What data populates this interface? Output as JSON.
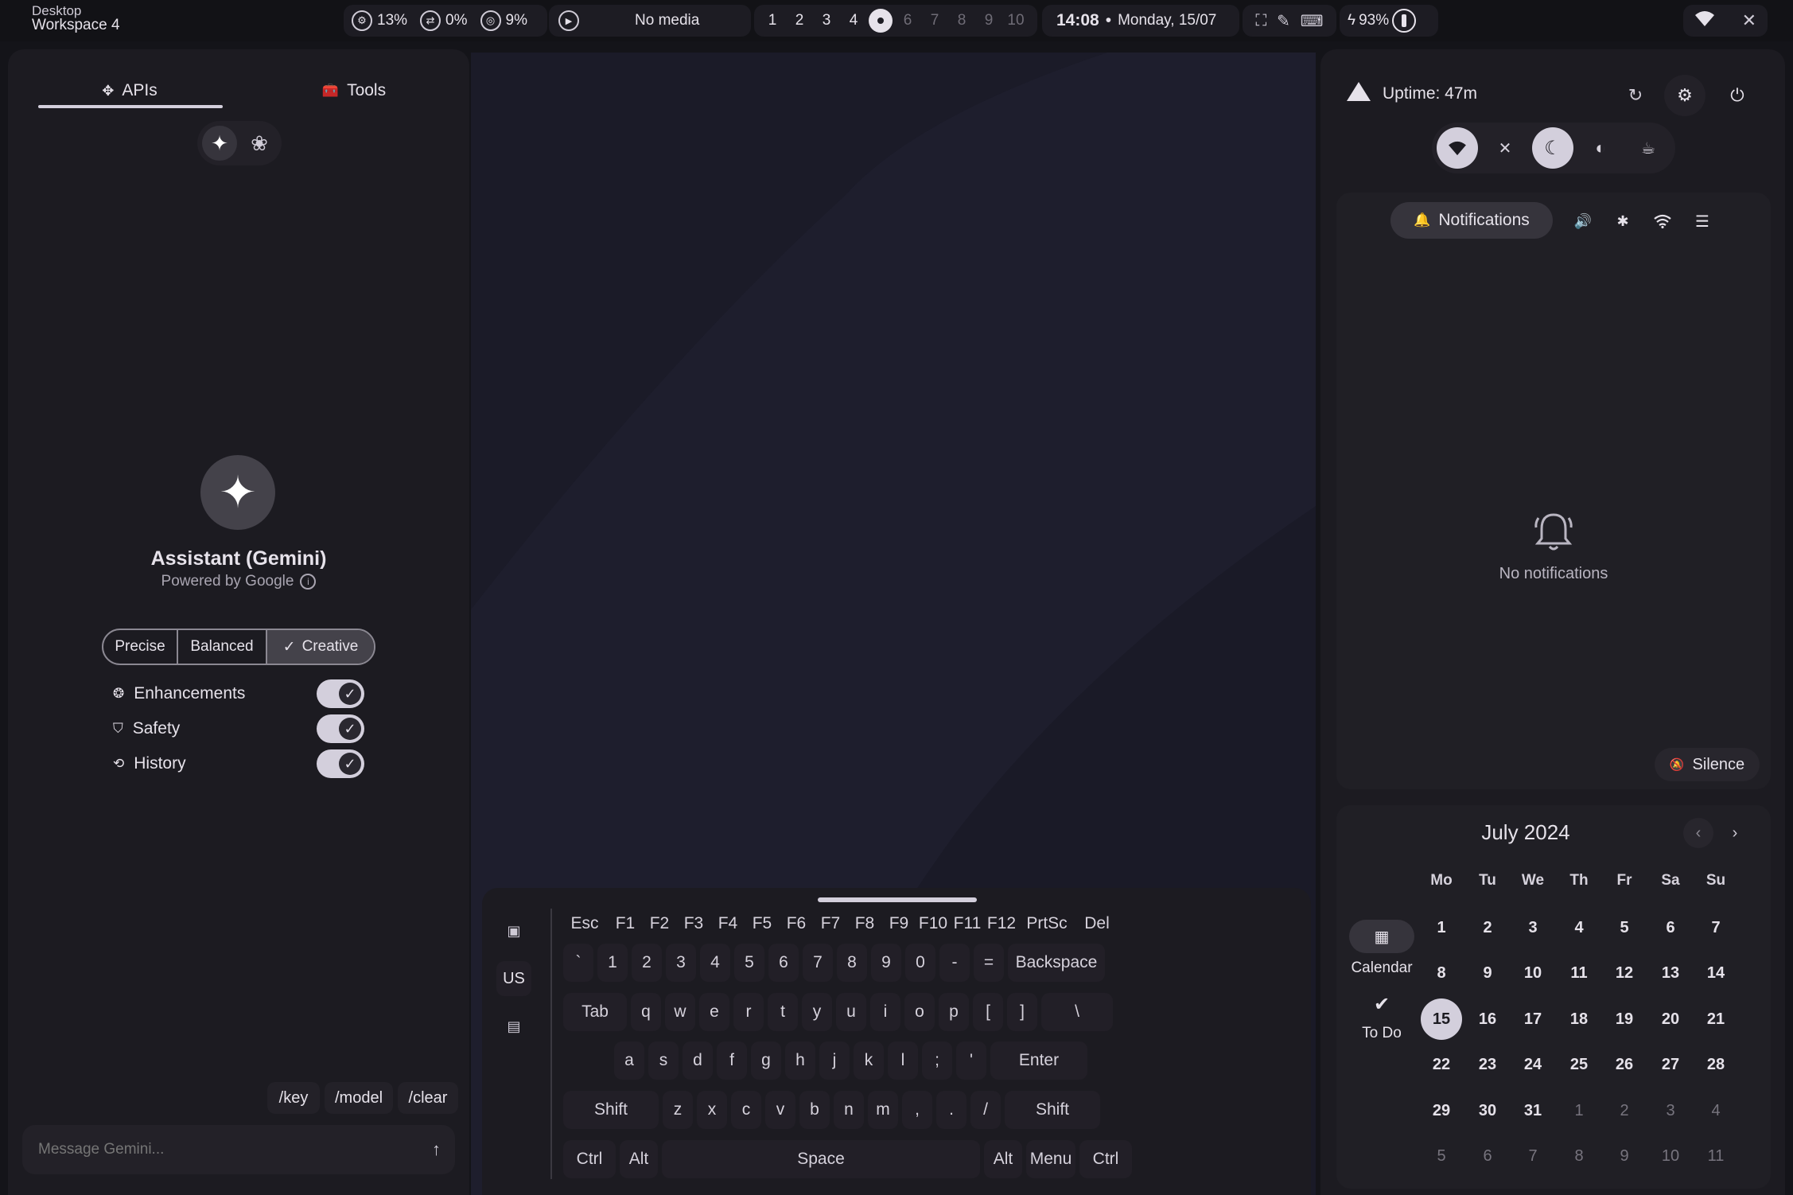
{
  "topbar": {
    "window_class": "Desktop",
    "window_title": "Workspace 4",
    "cpu": "13%",
    "swap": "0%",
    "ram": "9%",
    "media": "No media",
    "workspaces": [
      "1",
      "2",
      "3",
      "4",
      "",
      "6",
      "7",
      "8",
      "9",
      "10"
    ],
    "active_workspace": 5,
    "time": "14:08",
    "date": "Monday, 15/07",
    "battery": "93%"
  },
  "left_panel": {
    "tabs": [
      {
        "label": "APIs",
        "icon": "api-icon"
      },
      {
        "label": "Tools",
        "icon": "toolbox-icon"
      }
    ],
    "assistant_name": "Assistant (Gemini)",
    "powered_by": "Powered by Google",
    "modes": [
      "Precise",
      "Balanced",
      "Creative"
    ],
    "selected_mode": "Creative",
    "options": [
      {
        "label": "Enhancements",
        "icon": "sparkle-brain-icon",
        "on": true
      },
      {
        "label": "Safety",
        "icon": "shield-icon",
        "on": true
      },
      {
        "label": "History",
        "icon": "history-icon",
        "on": true
      }
    ],
    "commands": [
      "/key",
      "/model",
      "/clear"
    ],
    "input_placeholder": "Message Gemini..."
  },
  "keyboard": {
    "layout": "US",
    "rows": [
      [
        "Esc",
        "F1",
        "F2",
        "F3",
        "F4",
        "F5",
        "F6",
        "F7",
        "F8",
        "F9",
        "F10",
        "F11",
        "F12",
        "PrtSc",
        "Del"
      ],
      [
        "`",
        "1",
        "2",
        "3",
        "4",
        "5",
        "6",
        "7",
        "8",
        "9",
        "0",
        "-",
        "=",
        "Backspace"
      ],
      [
        "Tab",
        "q",
        "w",
        "e",
        "r",
        "t",
        "y",
        "u",
        "i",
        "o",
        "p",
        "[",
        "]",
        "\\"
      ],
      [
        "a",
        "s",
        "d",
        "f",
        "g",
        "h",
        "j",
        "k",
        "l",
        ";",
        "'",
        "Enter"
      ],
      [
        "Shift",
        "z",
        "x",
        "c",
        "v",
        "b",
        "n",
        "m",
        ",",
        ".",
        "/",
        "Shift"
      ],
      [
        "Ctrl",
        "Alt",
        "Space",
        "Alt",
        "Menu",
        "Ctrl"
      ]
    ]
  },
  "right_panel": {
    "uptime": "Uptime: 47m",
    "notif_tab": "Notifications",
    "no_notifications": "No notifications",
    "silence": "Silence",
    "calendar": {
      "month_label": "July 2024",
      "weekdays": [
        "Mo",
        "Tu",
        "We",
        "Th",
        "Fr",
        "Sa",
        "Su"
      ],
      "days": [
        [
          "1",
          "2",
          "3",
          "4",
          "5",
          "6",
          "7"
        ],
        [
          "8",
          "9",
          "10",
          "11",
          "12",
          "13",
          "14"
        ],
        [
          "15",
          "16",
          "17",
          "18",
          "19",
          "20",
          "21"
        ],
        [
          "22",
          "23",
          "24",
          "25",
          "26",
          "27",
          "28"
        ],
        [
          "29",
          "30",
          "31",
          "1",
          "2",
          "3",
          "4"
        ],
        [
          "5",
          "6",
          "7",
          "8",
          "9",
          "10",
          "11"
        ]
      ],
      "today": "15",
      "side_tabs": [
        {
          "label": "Calendar",
          "icon": "calendar-icon"
        },
        {
          "label": "To Do",
          "icon": "checkmark-icon"
        }
      ]
    }
  }
}
